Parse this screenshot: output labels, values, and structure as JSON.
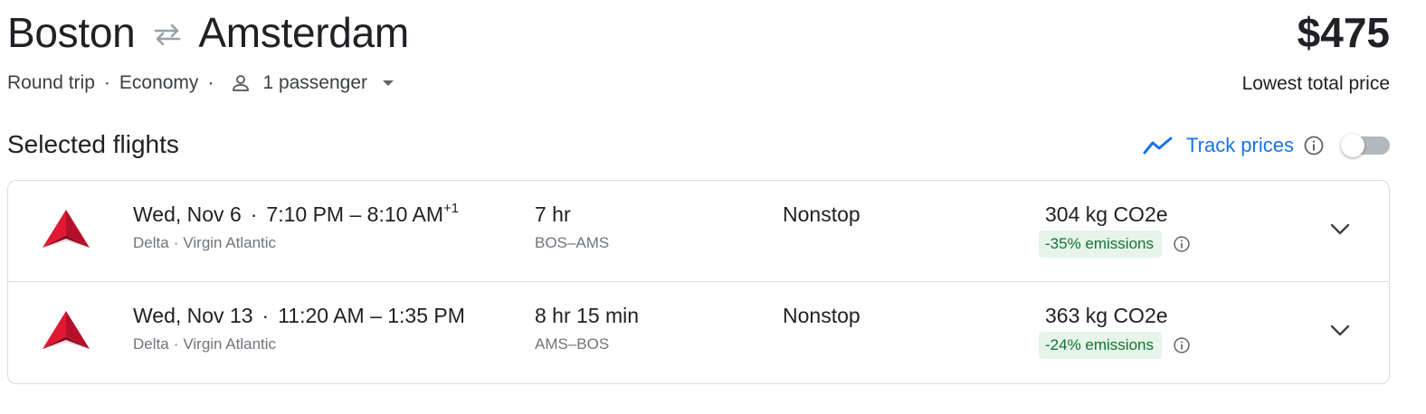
{
  "route": {
    "origin": "Boston",
    "destination": "Amsterdam",
    "swap_icon": "swap-arrows-icon"
  },
  "price": {
    "amount": "$475",
    "caption": "Lowest total price"
  },
  "trip": {
    "type": "Round trip",
    "cabin": "Economy",
    "passengers": "1 passenger",
    "separator": "·"
  },
  "section": {
    "title": "Selected flights"
  },
  "track_prices": {
    "label": "Track prices",
    "enabled": false,
    "accent_color": "#1a73e8"
  },
  "flights": [
    {
      "date": "Wed, Nov 6",
      "separator": "·",
      "times": "7:10 PM – 8:10 AM",
      "day_offset": "+1",
      "airlines": [
        "Delta",
        "Virgin Atlantic"
      ],
      "duration": "7 hr",
      "route": "BOS–AMS",
      "stops": "Nonstop",
      "emissions": "304 kg CO2e",
      "emissions_delta": "-35% emissions"
    },
    {
      "date": "Wed, Nov 13",
      "separator": "·",
      "times": "11:20 AM – 1:35 PM",
      "day_offset": "",
      "airlines": [
        "Delta",
        "Virgin Atlantic"
      ],
      "duration": "8 hr 15 min",
      "route": "AMS–BOS",
      "stops": "Nonstop",
      "emissions": "363 kg CO2e",
      "emissions_delta": "-24% emissions"
    }
  ],
  "colors": {
    "text": "#202124",
    "secondary_text": "#70757a",
    "emissions_badge_bg": "#e6f4ea",
    "emissions_badge_text": "#137333",
    "delta_logo_red": "#e01933"
  }
}
